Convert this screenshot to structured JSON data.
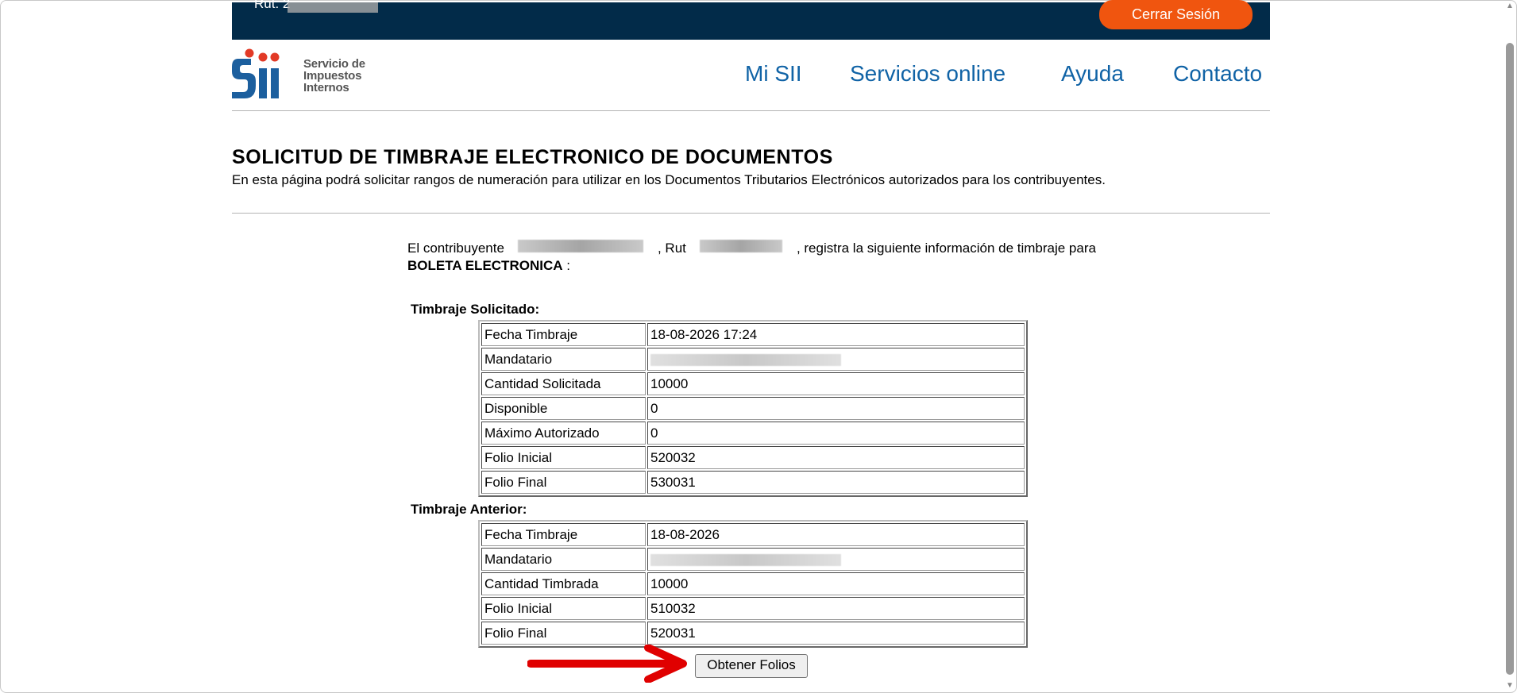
{
  "header": {
    "rut_label": "Rut: 2",
    "logout_label": "Cerrar Sesión",
    "logo_text": [
      "Servicio de",
      "Impuestos",
      "Internos"
    ],
    "nav": [
      "Mi SII",
      "Servicios online",
      "Ayuda",
      "Contacto"
    ],
    "brand_colors": {
      "dark_blue": "#022b49",
      "orange": "#f0550f",
      "link_blue": "#1063a6"
    }
  },
  "page": {
    "title": "SOLICITUD DE TIMBRAJE ELECTRONICO DE DOCUMENTOS",
    "subtitle": "En esta página podrá solicitar rangos de numeración para utilizar en los Documentos Tributarios Electrónicos autorizados para los contribuyentes."
  },
  "info": {
    "prefix": "El contribuyente",
    "rut_text": ", Rut",
    "suffix": ", registra la siguiente información de timbraje para",
    "document_type": "BOLETA ELECTRONICA",
    "colon": ":"
  },
  "requested": {
    "label": "Timbraje Solicitado:",
    "rows": [
      [
        "Fecha Timbraje",
        "18-08-2026 17:24"
      ],
      [
        "Mandatario",
        ""
      ],
      [
        "Cantidad Solicitada",
        "10000"
      ],
      [
        "Disponible",
        "0"
      ],
      [
        "Máximo Autorizado",
        "0"
      ],
      [
        "Folio Inicial",
        "520032"
      ],
      [
        "Folio Final",
        "530031"
      ]
    ]
  },
  "previous": {
    "label": "Timbraje Anterior:",
    "rows": [
      [
        "Fecha Timbraje",
        "18-08-2026"
      ],
      [
        "Mandatario",
        ""
      ],
      [
        "Cantidad Timbrada",
        "10000"
      ],
      [
        "Folio Inicial",
        "510032"
      ],
      [
        "Folio Final",
        "520031"
      ]
    ]
  },
  "actions": {
    "submit_label": "Obtener Folios"
  },
  "annotation": {
    "arrow_color": "#e00000"
  }
}
